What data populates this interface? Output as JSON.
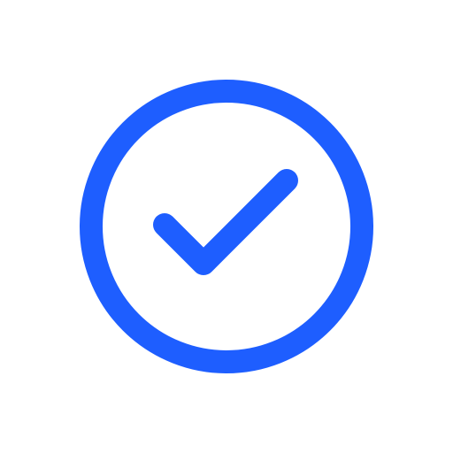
{
  "icon": {
    "name": "check-circle-icon",
    "stroke_color": "#1E5EFF",
    "background_color": "#FFFFFF"
  }
}
